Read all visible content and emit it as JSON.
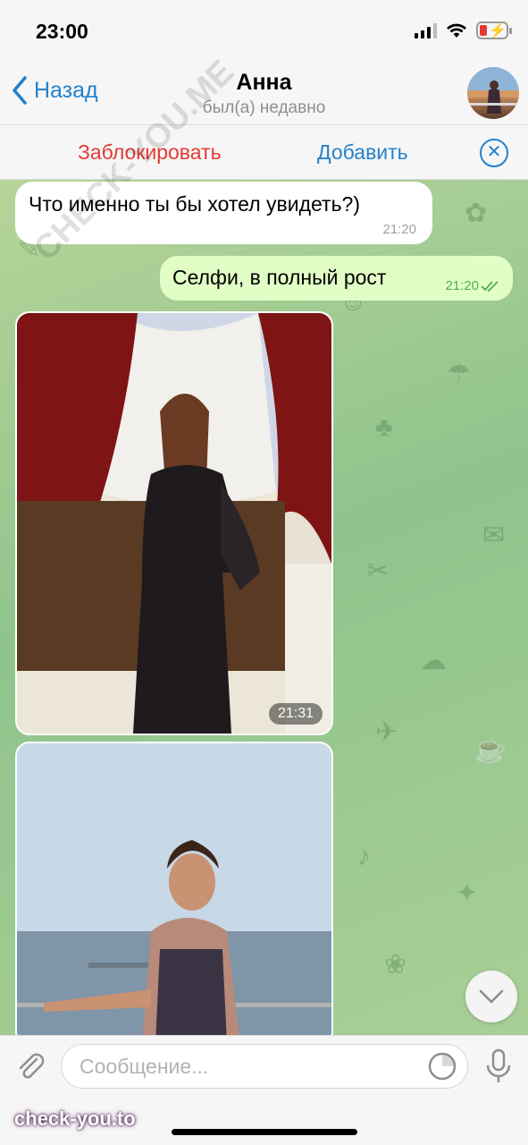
{
  "status_bar": {
    "time": "23:00"
  },
  "nav": {
    "back_label": "Назад",
    "title": "Анна",
    "subtitle": "был(а) недавно"
  },
  "actions": {
    "block_label": "Заблокировать",
    "add_label": "Добавить"
  },
  "messages": [
    {
      "direction": "in",
      "text": "Что именно ты бы хотел увидеть?)",
      "time": "21:20"
    },
    {
      "direction": "out",
      "text": "Селфи, в полный рост",
      "time": "21:20",
      "status": "read"
    },
    {
      "direction": "in",
      "type": "photo",
      "time": "21:31",
      "description": "photo"
    },
    {
      "direction": "in",
      "type": "photo",
      "description": "photo"
    }
  ],
  "input": {
    "placeholder": "Сообщение..."
  },
  "watermark": {
    "logo": "check-you.to",
    "diagonal": "CHECK-YOU.ME"
  },
  "colors": {
    "accent": "#2481cc",
    "danger": "#e53935",
    "outgoing_bubble": "#e1fec6",
    "read_check": "#4fae4e"
  },
  "icons": [
    "back-chevron-icon",
    "close-circle-icon",
    "paperclip-icon",
    "sticker-icon",
    "microphone-icon",
    "chevron-down-icon",
    "read-check-icon"
  ]
}
